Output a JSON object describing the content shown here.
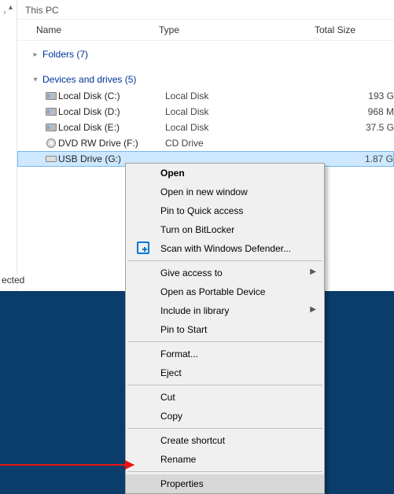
{
  "path": "This PC",
  "columns": {
    "name": "Name",
    "type": "Type",
    "size": "Total Size"
  },
  "groups": {
    "folders": {
      "label": "Folders (7)",
      "expanded": false
    },
    "drives": {
      "label": "Devices and drives (5)",
      "expanded": true
    }
  },
  "drives": [
    {
      "icon": "hdd",
      "name": "Local Disk (C:)",
      "type": "Local Disk",
      "size": "193 G"
    },
    {
      "icon": "hdd",
      "name": "Local Disk (D:)",
      "type": "Local Disk",
      "size": "968 M"
    },
    {
      "icon": "hdd",
      "name": "Local Disk (E:)",
      "type": "Local Disk",
      "size": "37.5 G"
    },
    {
      "icon": "dvd",
      "name": "DVD RW Drive (F:)",
      "type": "CD Drive",
      "size": ""
    },
    {
      "icon": "usb",
      "name": "USB Drive (G:)",
      "type": "",
      "size": "1.87 G",
      "selected": true
    }
  ],
  "status_fragment": "ected",
  "context_menu": {
    "items": [
      {
        "label": "Open",
        "bold": true
      },
      {
        "label": "Open in new window"
      },
      {
        "label": "Pin to Quick access"
      },
      {
        "label": "Turn on BitLocker"
      },
      {
        "label": "Scan with Windows Defender...",
        "icon": "defender"
      },
      {
        "sep": true
      },
      {
        "label": "Give access to",
        "submenu": true
      },
      {
        "label": "Open as Portable Device"
      },
      {
        "label": "Include in library",
        "submenu": true
      },
      {
        "label": "Pin to Start"
      },
      {
        "sep": true
      },
      {
        "label": "Format..."
      },
      {
        "label": "Eject"
      },
      {
        "sep": true
      },
      {
        "label": "Cut"
      },
      {
        "label": "Copy"
      },
      {
        "sep": true
      },
      {
        "label": "Create shortcut"
      },
      {
        "label": "Rename"
      },
      {
        "sep": true
      },
      {
        "label": "Properties",
        "highlighted": true
      }
    ]
  }
}
